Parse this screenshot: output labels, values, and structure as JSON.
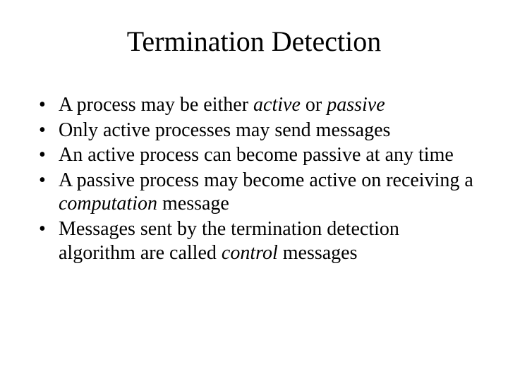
{
  "slide": {
    "title": "Termination Detection",
    "bullets": [
      {
        "segments": [
          {
            "text": "A process may be either ",
            "italic": false
          },
          {
            "text": "active",
            "italic": true
          },
          {
            "text": " or ",
            "italic": false
          },
          {
            "text": "passive",
            "italic": true
          }
        ]
      },
      {
        "segments": [
          {
            "text": "Only active processes may send messages",
            "italic": false
          }
        ]
      },
      {
        "segments": [
          {
            "text": "An active process can become passive at any time",
            "italic": false
          }
        ]
      },
      {
        "segments": [
          {
            "text": "A passive process may become active on receiving a ",
            "italic": false
          },
          {
            "text": "computation",
            "italic": true
          },
          {
            "text": " message",
            "italic": false
          }
        ]
      },
      {
        "segments": [
          {
            "text": "Messages sent by the termination detection algorithm are called ",
            "italic": false
          },
          {
            "text": "control",
            "italic": true
          },
          {
            "text": " messages",
            "italic": false
          }
        ]
      }
    ]
  }
}
